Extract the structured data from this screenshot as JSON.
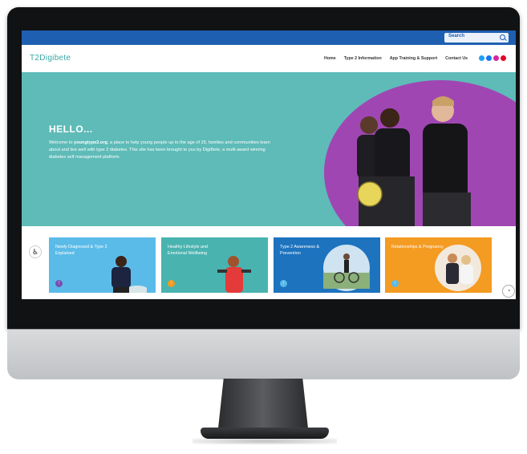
{
  "colors": {
    "topbar": "#1f5fb1",
    "hero_bg": "#5ebbb8",
    "hero_blob": "#a046b3",
    "logo": "#3aa7a4"
  },
  "search": {
    "label": "Search",
    "icon": "search-icon"
  },
  "site": {
    "logo_text": "T2Digibete"
  },
  "nav": {
    "items": [
      "Home",
      "Type 2 Information",
      "App Training & Support",
      "Contact Us"
    ]
  },
  "social": [
    {
      "icon": "twitter-icon",
      "color": "#1da1f2"
    },
    {
      "icon": "facebook-icon",
      "color": "#1877f2"
    },
    {
      "icon": "instagram-icon",
      "color": "#d6249f"
    },
    {
      "icon": "pinterest-icon",
      "color": "#e60023"
    }
  ],
  "hero": {
    "heading": "HELLO...",
    "intro_before": "Welcome to ",
    "intro_bold": "youngtype2.org",
    "intro_after": ", a place to help young people up to the age of 25, families and communities learn about and live well with type 2 diabetes. This site has been brought to you by DigiBete, a multi award winning diabetes self management platform."
  },
  "cards": [
    {
      "label": "Newly Diagnosed & Type 2 Explained",
      "color": "#5bbbe8",
      "arrow_color": "#7a4fb3"
    },
    {
      "label": "Healthy Lifestyle and Emotional Wellbeing",
      "color": "#49b3b0",
      "arrow_color": "#f39a20"
    },
    {
      "label": "Type 2 Awareness & Prevention",
      "color": "#1d73be",
      "arrow_color": "#5bbbe8"
    },
    {
      "label": "Relationships & Pregnancy",
      "color": "#f49b22",
      "arrow_color": "#5bbbe8"
    }
  ],
  "widgets": {
    "accessibility_icon": "accessibility-icon",
    "cookie_icon": "cookie-icon"
  }
}
